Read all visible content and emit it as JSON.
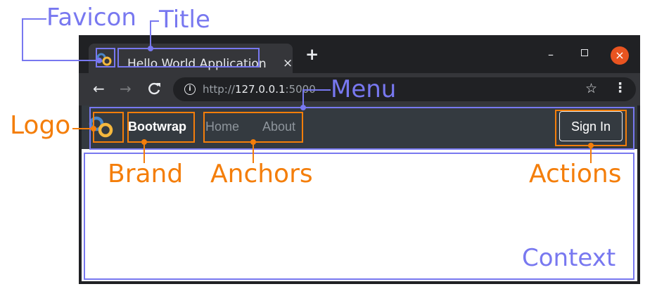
{
  "browser": {
    "tab": {
      "title": "Hello World Application",
      "close_glyph": "×"
    },
    "new_tab_glyph": "+",
    "window_controls": {
      "minimize_glyph": "–",
      "close_glyph": "×"
    },
    "toolbar": {
      "back_glyph": "←",
      "forward_glyph": "→",
      "reload_glyph": "C",
      "info_glyph": "i",
      "url_scheme": "http://",
      "url_host": "127.0.0.1",
      "url_port": ":5000",
      "star_glyph": "☆",
      "menu_glyph": "⋮"
    },
    "icons": [
      "favicon-icon",
      "back-arrow-icon",
      "forward-arrow-icon",
      "reload-icon",
      "info-icon",
      "star-icon",
      "kebab-menu-icon",
      "close-icon",
      "plus-icon",
      "minimize-icon",
      "maximize-icon"
    ]
  },
  "page": {
    "brand": "Bootwrap",
    "nav_links": [
      "Home",
      "About"
    ],
    "action_button": "Sign In"
  },
  "annotations": {
    "favicon": "Favicon",
    "title": "Title",
    "menu": "Menu",
    "context": "Context",
    "logo": "Logo",
    "brand": "Brand",
    "anchors": "Anchors",
    "actions": "Actions"
  },
  "colors": {
    "annotation_blue": "#7878f0",
    "annotation_orange": "#f47e0a",
    "navbar_bg": "#343a40",
    "browser_frame": "#202124",
    "ubuntu_close": "#e95420"
  }
}
